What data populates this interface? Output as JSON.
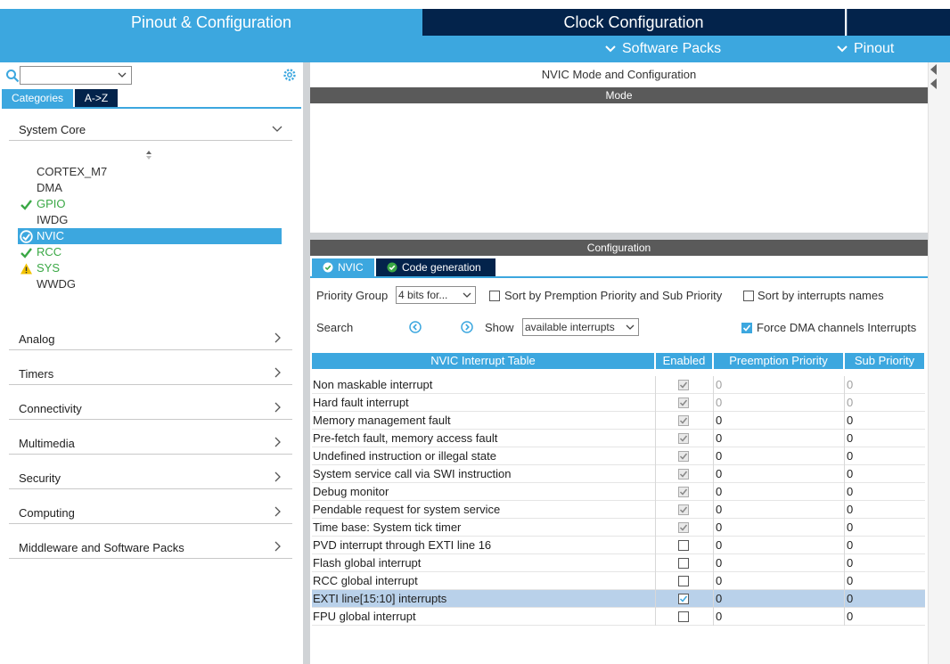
{
  "header": {
    "tab_pinout": "Pinout & Configuration",
    "tab_clock": "Clock Configuration",
    "software_packs": "Software Packs",
    "pinout_menu": "Pinout"
  },
  "left": {
    "tabs": {
      "categories": "Categories",
      "az": "A->Z"
    },
    "system_core": {
      "title": "System Core",
      "items": [
        {
          "label": "CORTEX_M7",
          "status": "none"
        },
        {
          "label": "DMA",
          "status": "none"
        },
        {
          "label": "GPIO",
          "status": "ok"
        },
        {
          "label": "IWDG",
          "status": "none"
        },
        {
          "label": "NVIC",
          "status": "ok-selected"
        },
        {
          "label": "RCC",
          "status": "ok"
        },
        {
          "label": "SYS",
          "status": "warning"
        },
        {
          "label": "WWDG",
          "status": "none"
        }
      ]
    },
    "sections": [
      "Analog",
      "Timers",
      "Connectivity",
      "Multimedia",
      "Security",
      "Computing",
      "Middleware and Software Packs"
    ]
  },
  "right": {
    "title": "NVIC Mode and Configuration",
    "mode_bar": "Mode",
    "config_bar": "Configuration",
    "tabs": {
      "nvic": "NVIC",
      "codegen": "Code generation"
    },
    "priority_group_label": "Priority Group",
    "priority_group_value": "4 bits for...",
    "sort_premption": "Sort by Premption Priority and Sub Priority",
    "sort_names": "Sort by interrupts names",
    "search_label": "Search",
    "show_label": "Show",
    "show_value": "available interrupts",
    "force_dma": "Force DMA channels Interrupts",
    "table": {
      "headers": [
        "NVIC Interrupt Table",
        "Enabled",
        "Preemption Priority",
        "Sub Priority"
      ],
      "rows": [
        {
          "name": "Non maskable interrupt",
          "enabled": "locked",
          "pre": "0",
          "sub": "0",
          "dim": true
        },
        {
          "name": "Hard fault interrupt",
          "enabled": "locked",
          "pre": "0",
          "sub": "0",
          "dim": true
        },
        {
          "name": "Memory management fault",
          "enabled": "locked",
          "pre": "0",
          "sub": "0",
          "dim": false
        },
        {
          "name": "Pre-fetch fault, memory access fault",
          "enabled": "locked",
          "pre": "0",
          "sub": "0",
          "dim": false
        },
        {
          "name": "Undefined instruction or illegal state",
          "enabled": "locked",
          "pre": "0",
          "sub": "0",
          "dim": false
        },
        {
          "name": "System service call via SWI instruction",
          "enabled": "locked",
          "pre": "0",
          "sub": "0",
          "dim": false
        },
        {
          "name": "Debug monitor",
          "enabled": "locked",
          "pre": "0",
          "sub": "0",
          "dim": false
        },
        {
          "name": "Pendable request for system service",
          "enabled": "locked",
          "pre": "0",
          "sub": "0",
          "dim": false
        },
        {
          "name": "Time base: System tick timer",
          "enabled": "locked",
          "pre": "0",
          "sub": "0",
          "dim": false
        },
        {
          "name": "PVD interrupt through EXTI line 16",
          "enabled": "off",
          "pre": "0",
          "sub": "0",
          "dim": false
        },
        {
          "name": "Flash global interrupt",
          "enabled": "off",
          "pre": "0",
          "sub": "0",
          "dim": false
        },
        {
          "name": "RCC global interrupt",
          "enabled": "off",
          "pre": "0",
          "sub": "0",
          "dim": false
        },
        {
          "name": "EXTI line[15:10] interrupts",
          "enabled": "on",
          "pre": "0",
          "sub": "0",
          "dim": false
        },
        {
          "name": "FPU global interrupt",
          "enabled": "off",
          "pre": "0",
          "sub": "0",
          "dim": false
        }
      ]
    }
  },
  "colors": {
    "accent": "#3ca7df",
    "dark": "#03234b",
    "ok": "#3aa845",
    "warning": "#f2c200",
    "highlight": "#b9d1ea"
  }
}
